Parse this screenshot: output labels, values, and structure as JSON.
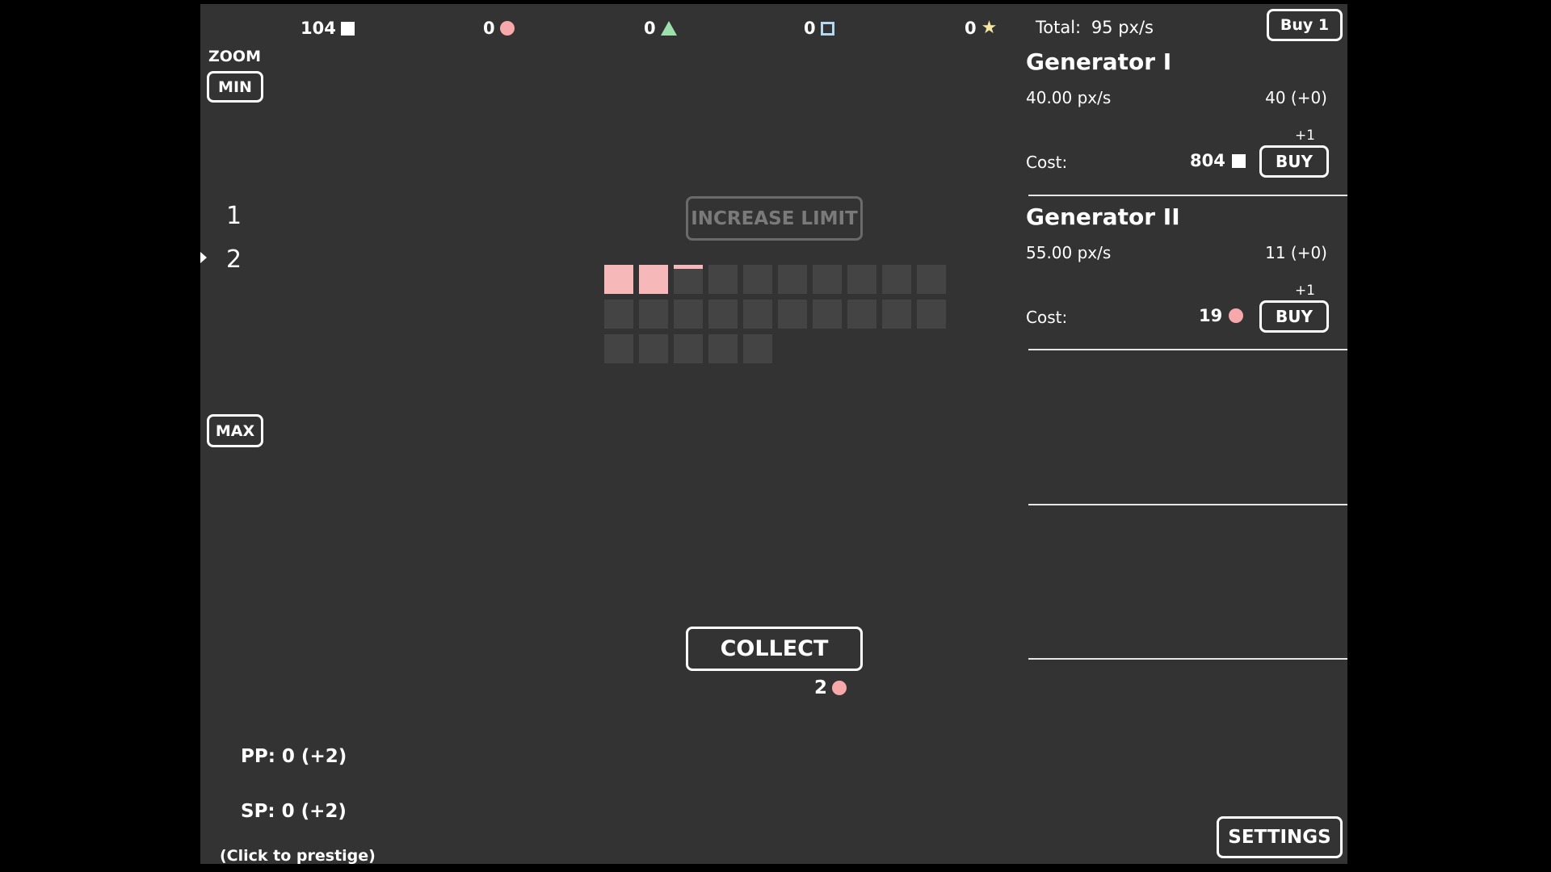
{
  "resources": [
    {
      "value": "104",
      "icon": "square-icon"
    },
    {
      "value": "0",
      "icon": "circle-icon"
    },
    {
      "value": "0",
      "icon": "triangle-icon"
    },
    {
      "value": "0",
      "icon": "hollow-square-icon"
    },
    {
      "value": "0",
      "icon": "star-icon"
    }
  ],
  "total": {
    "label": "Total:",
    "value": "95 px/s"
  },
  "buy_mode": "Buy 1",
  "zoom": {
    "label": "ZOOM",
    "min": "MIN",
    "max": "MAX"
  },
  "layers": [
    "1",
    "2"
  ],
  "increase_limit": "INCREASE LIMIT",
  "grid": {
    "total_cells": 25,
    "full_cells": 2,
    "partial_fill": 0.15
  },
  "collect": {
    "label": "COLLECT",
    "reward": "2"
  },
  "generators": [
    {
      "name": "Generator I",
      "rate": "40.00 px/s",
      "count": "40 (+0)",
      "plus": "+1",
      "cost_label": "Cost:",
      "cost": "804",
      "buy": "BUY"
    },
    {
      "name": "Generator II",
      "rate": "55.00 px/s",
      "count": "11 (+0)",
      "plus": "+1",
      "cost_label": "Cost:",
      "cost": "19",
      "buy": "BUY"
    }
  ],
  "prestige": {
    "pp": "PP: 0 (+2)",
    "sp": "SP: 0 (+2)",
    "hint": "(Click to prestige)"
  },
  "settings": "SETTINGS"
}
